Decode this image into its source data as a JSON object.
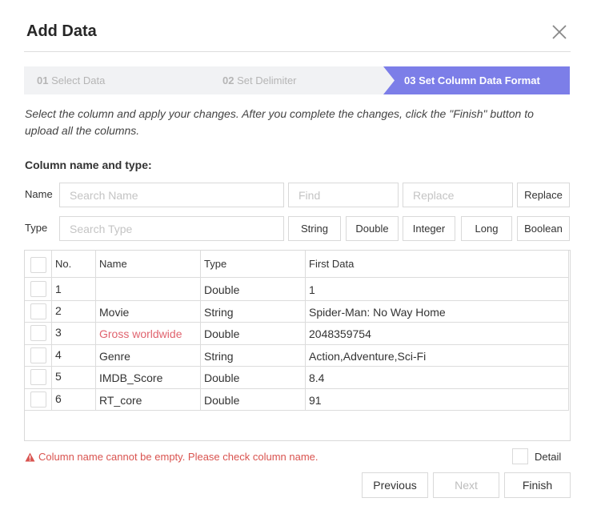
{
  "dialog": {
    "title": "Add Data"
  },
  "steps": [
    {
      "num": "01",
      "label": "Select Data"
    },
    {
      "num": "02",
      "label": "Set Delimiter"
    },
    {
      "num": "03",
      "label": "Set Column Data Format"
    }
  ],
  "accent_color": "#7c7ee8",
  "description": "Select the column and apply your changes. After you complete the changes, click the \"Finish\" button to upload all the columns.",
  "section_title": "Column name and type:",
  "name_row": {
    "label": "Name",
    "search_placeholder": "Search Name",
    "find_placeholder": "Find",
    "replace_placeholder": "Replace",
    "replace_button": "Replace"
  },
  "type_row": {
    "label": "Type",
    "search_placeholder": "Search Type",
    "types": [
      "String",
      "Double",
      "Integer",
      "Long",
      "Boolean"
    ]
  },
  "table": {
    "headers": {
      "no": "No.",
      "name": "Name",
      "type": "Type",
      "first": "First Data"
    },
    "rows": [
      {
        "no": "1",
        "name": "",
        "type": "Double",
        "first": "1"
      },
      {
        "no": "2",
        "name": "Movie",
        "type": "String",
        "first": "Spider-Man: No Way Home"
      },
      {
        "no": "3",
        "name": "Gross worldwide",
        "type": "Double",
        "first": "2048359754"
      },
      {
        "no": "4",
        "name": "Genre",
        "type": "String",
        "first": "Action,Adventure,Sci-Fi"
      },
      {
        "no": "5",
        "name": "IMDB_Score",
        "type": "Double",
        "first": "8.4"
      },
      {
        "no": "6",
        "name": "RT_core",
        "type": "Double",
        "first": "91"
      }
    ]
  },
  "error_message": "Column name cannot be empty. Please check column name.",
  "detail_label": "Detail",
  "footer": {
    "previous": "Previous",
    "next": "Next",
    "finish": "Finish"
  }
}
